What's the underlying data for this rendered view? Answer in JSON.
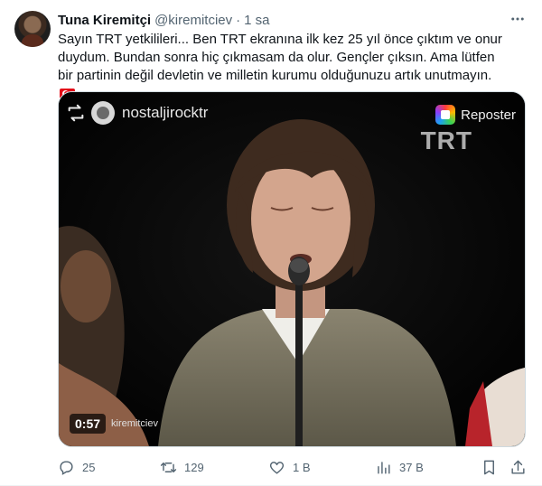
{
  "tweet": {
    "display_name": "Tuna Kiremitçi",
    "handle": "@kiremitciev",
    "separator": "·",
    "time": "1 sa",
    "text": "Sayın TRT yetkilileri... Ben TRT ekranına ilk kez 25 yıl önce çıktım ve onur duydum. Bundan sonra hiç çıkmasam da olur. Gençler çıksın. Ama lütfen bir partinin değil devletin ve milletin kurumu olduğunuzu artık unutmayın. ",
    "emoji": "turkey-flag"
  },
  "media": {
    "repost_user": "nostaljirocktr",
    "reposter_label": "Reposter",
    "watermark": "TRT",
    "duration": "0:57",
    "duration_author": "kiremitciev"
  },
  "actions": {
    "replies": "25",
    "retweets": "129",
    "likes": "1 B",
    "views": "37 B"
  },
  "colors": {
    "text": "#0f1419",
    "secondary": "#536471",
    "border": "#cfd9de"
  }
}
